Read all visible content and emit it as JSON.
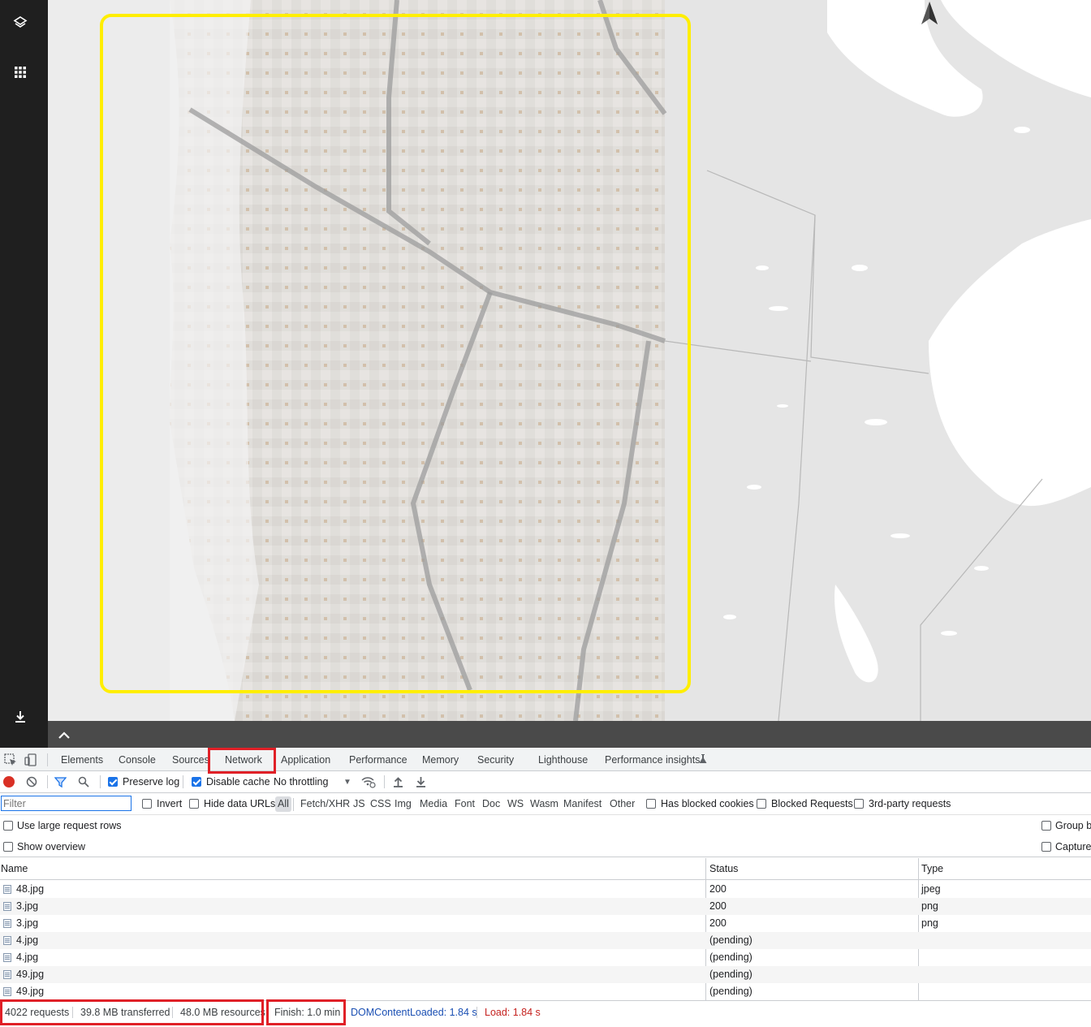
{
  "app": {
    "rail": {
      "layers_icon": "layers-icon",
      "apps_icon": "grid-apps-icon",
      "download_icon": "download-icon"
    },
    "footer": {
      "collapse_icon": "chevron-up-icon"
    },
    "compass_icon": "north-arrow-icon",
    "highlight_color": "#ffee00"
  },
  "devtools": {
    "tabs": [
      "Elements",
      "Console",
      "Sources",
      "Network",
      "Application",
      "Performance",
      "Memory",
      "Security",
      "Lighthouse",
      "Performance insights"
    ],
    "active_tab": "Network",
    "toolbar": {
      "preserve_log": "Preserve log",
      "disable_cache": "Disable cache",
      "throttling": "No throttling"
    },
    "filter": {
      "placeholder": "Filter",
      "invert": "Invert",
      "hide_data_urls": "Hide data URLs",
      "types": [
        "All",
        "Fetch/XHR",
        "JS",
        "CSS",
        "Img",
        "Media",
        "Font",
        "Doc",
        "WS",
        "Wasm",
        "Manifest",
        "Other"
      ],
      "has_blocked_cookies": "Has blocked cookies",
      "blocked_requests": "Blocked Requests",
      "third_party": "3rd-party requests"
    },
    "options": {
      "large_rows": "Use large request rows",
      "show_overview": "Show overview",
      "group_by": "Group b",
      "capture": "Capture"
    },
    "columns": {
      "name": "Name",
      "status": "Status",
      "type": "Type"
    },
    "rows": [
      {
        "name": "48.jpg",
        "status": "200",
        "type": "jpeg"
      },
      {
        "name": "3.jpg",
        "status": "200",
        "type": "png"
      },
      {
        "name": "3.jpg",
        "status": "200",
        "type": "png"
      },
      {
        "name": "4.jpg",
        "status": "(pending)",
        "type": ""
      },
      {
        "name": "4.jpg",
        "status": "(pending)",
        "type": ""
      },
      {
        "name": "49.jpg",
        "status": "(pending)",
        "type": ""
      },
      {
        "name": "49.jpg",
        "status": "(pending)",
        "type": ""
      }
    ],
    "summary": {
      "requests": "4022 requests",
      "transferred": "39.8 MB transferred",
      "resources": "48.0 MB resources",
      "finish": "Finish: 1.0 min",
      "dom_content_loaded": "DOMContentLoaded: 1.84 s",
      "load": "Load: 1.84 s",
      "dcl_color": "#1a4fb3",
      "load_color": "#c5221f"
    }
  }
}
